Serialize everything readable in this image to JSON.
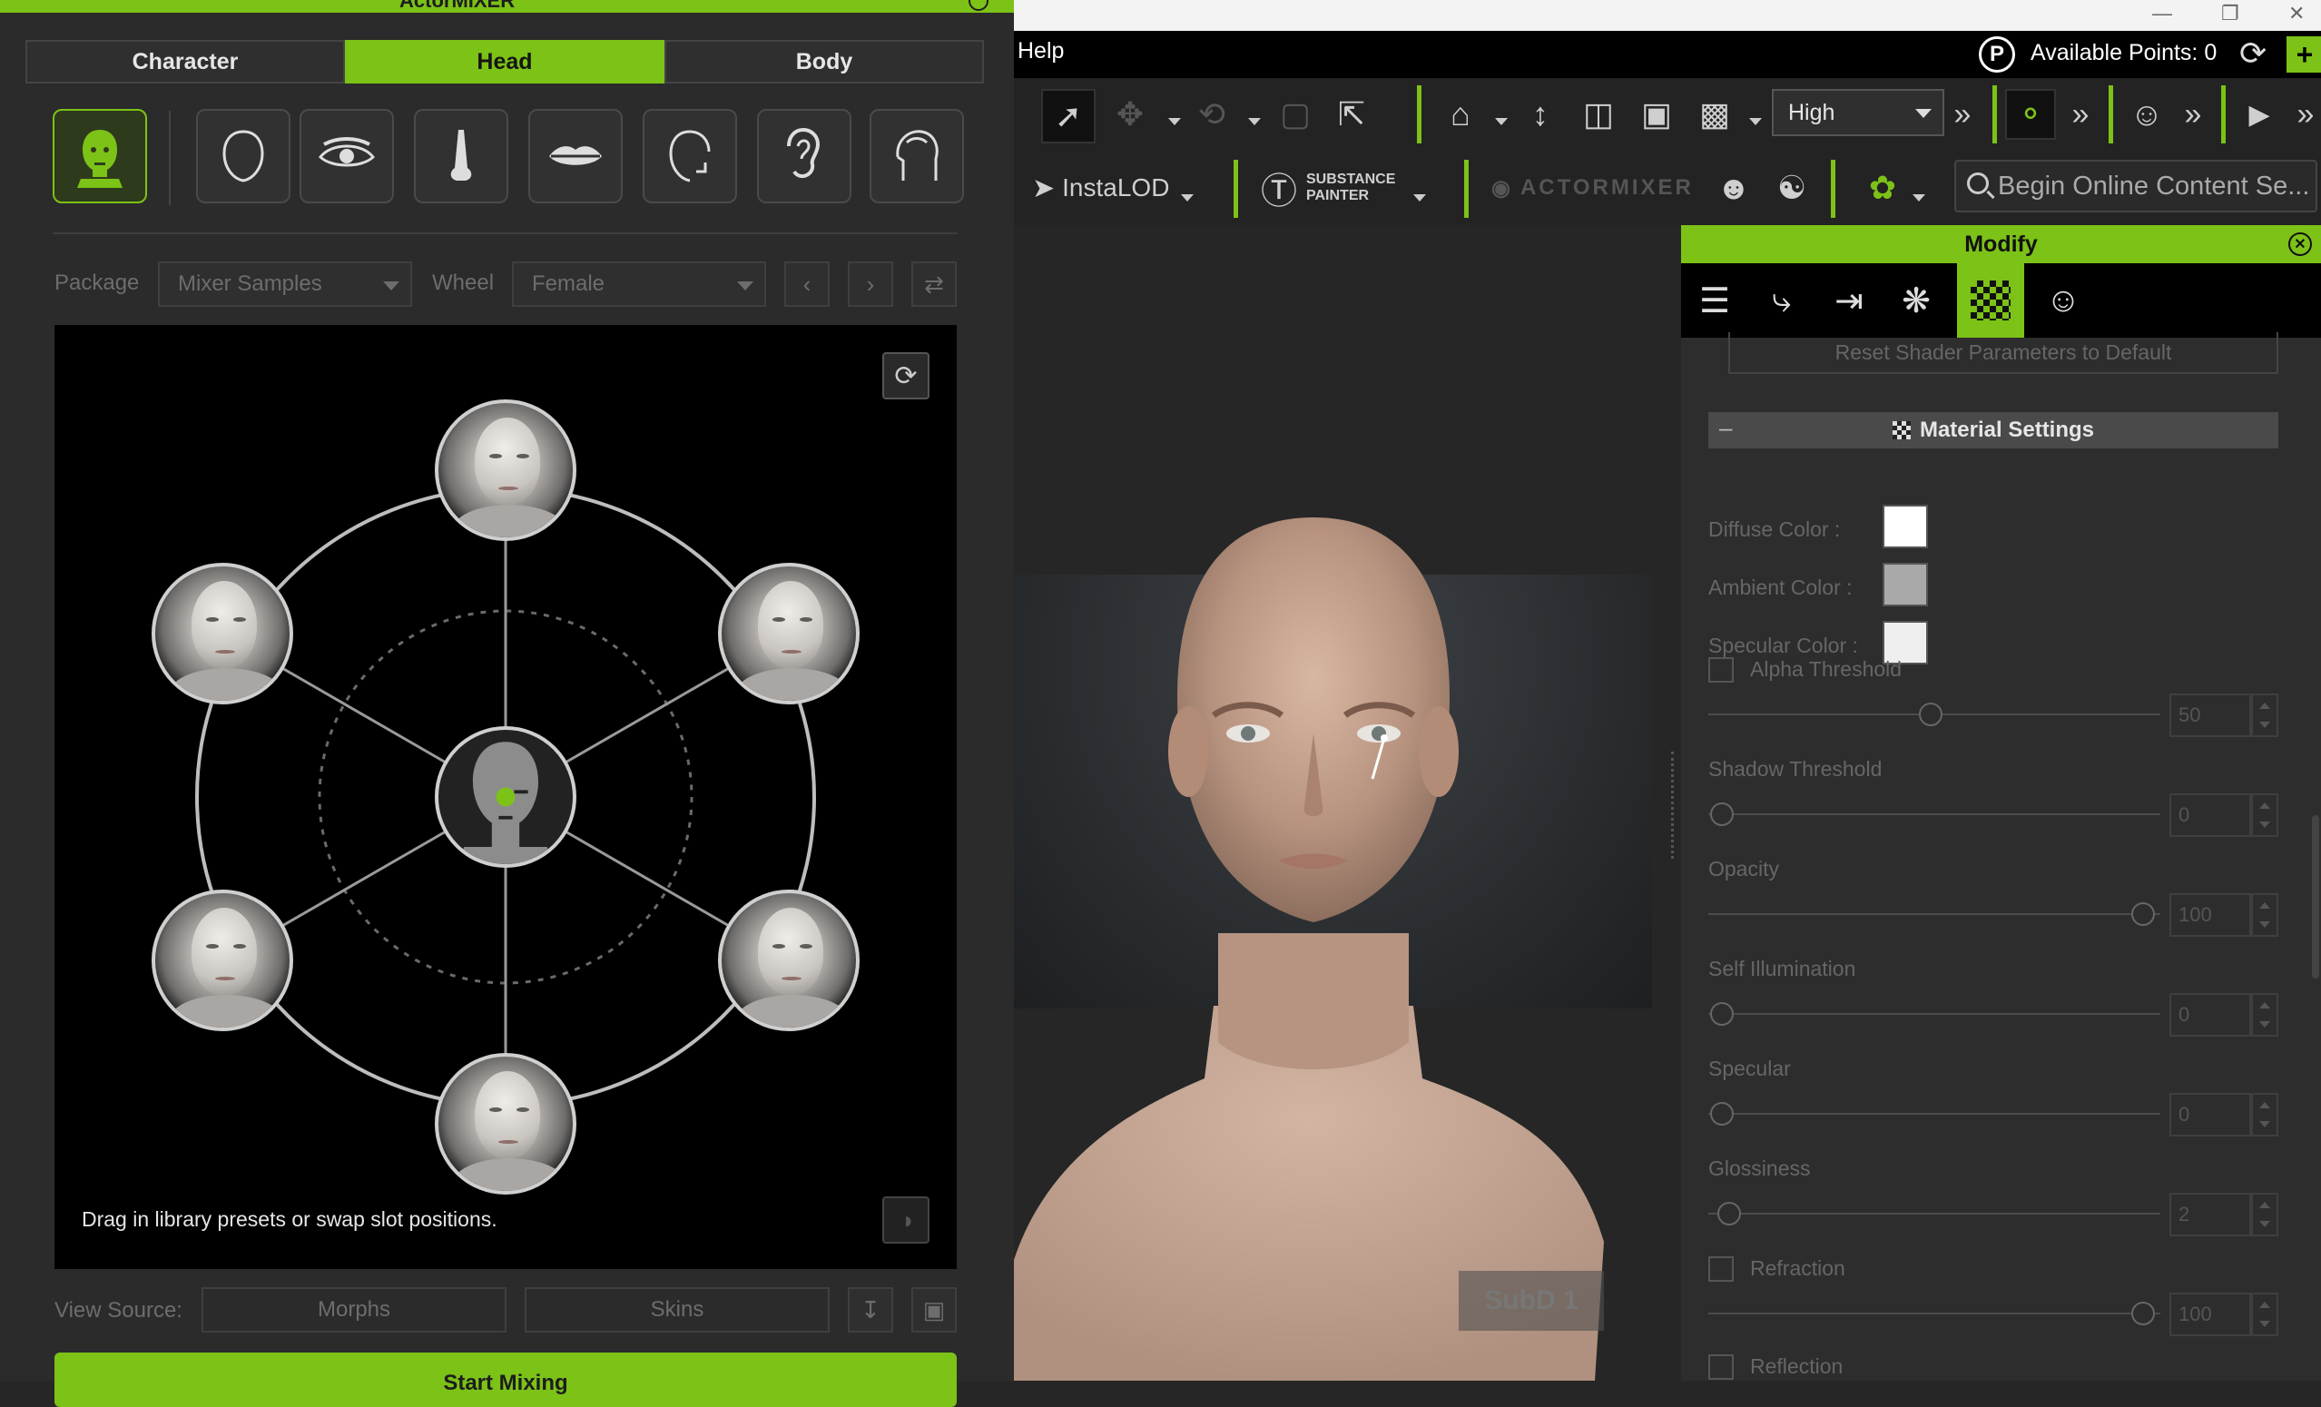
{
  "left_panel": {
    "title": "ActorMIXER",
    "tabs": [
      {
        "label": "Character",
        "active": false
      },
      {
        "label": "Head",
        "active": true
      },
      {
        "label": "Body",
        "active": false
      }
    ],
    "features": [
      "head-icon",
      "face-shape-icon",
      "eye-icon",
      "nose-icon",
      "lips-icon",
      "jaw-icon",
      "ear-icon",
      "skull-icon"
    ],
    "package_label": "Package",
    "package_value": "Mixer Samples",
    "wheel_label": "Wheel",
    "wheel_value": "Female",
    "wheel_hint": "Drag in library presets or swap slot positions.",
    "view_source_label": "View Source:",
    "morphs_label": "Morphs",
    "skins_label": "Skins",
    "start_mixing_label": "Start Mixing"
  },
  "menubar": {
    "help": "Help",
    "points_icon": "P",
    "available_points": "Available Points: 0",
    "plus": "+"
  },
  "toolbar": {
    "quality_value": "High",
    "instalod_label": "InstaLOD",
    "substance_label_1": "SUBSTANCE",
    "substance_label_2": "PAINTER",
    "actormixer_label": "ACTORMIXER",
    "search_placeholder": "Begin Online Content Se..."
  },
  "viewport": {
    "subd_label": "SubD 1"
  },
  "modify_panel": {
    "title": "Modify",
    "reset_shader": "Reset Shader Parameters to Default",
    "material_settings": "Material Settings",
    "diffuse_color_label": "Diffuse Color :",
    "ambient_color_label": "Ambient Color :",
    "specular_color_label": "Specular Color :",
    "diffuse_color": "#ffffff",
    "ambient_color": "#a9a9a9",
    "specular_color": "#efefef",
    "alpha_threshold_label": "Alpha Threshold",
    "alpha_threshold_value": "50",
    "shadow_threshold_label": "Shadow Threshold",
    "shadow_threshold_value": "0",
    "opacity_label": "Opacity",
    "opacity_value": "100",
    "self_illumination_label": "Self Illumination",
    "self_illumination_value": "0",
    "specular_label": "Specular",
    "specular_value": "0",
    "glossiness_label": "Glossiness",
    "glossiness_value": "2",
    "refraction_label": "Refraction",
    "refraction_value": "100",
    "reflection_label": "Reflection"
  },
  "colors": {
    "accent": "#7cc217",
    "panel": "#2b2b2b",
    "toolbar": "#232323"
  }
}
